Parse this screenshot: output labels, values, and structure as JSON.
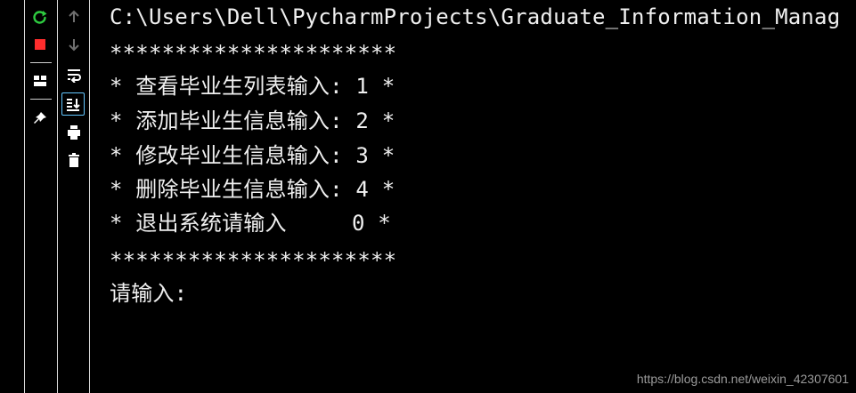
{
  "toolbar_left": {
    "icons": [
      "rerun-icon",
      "stop-icon",
      "layout-icon",
      "pin-icon"
    ]
  },
  "toolbar_mid": {
    "icons": [
      "up-arrow-icon",
      "down-arrow-icon",
      "soft-wrap-icon",
      "scroll-to-end-icon",
      "print-icon",
      "trash-icon"
    ]
  },
  "console": {
    "path": "C:\\Users\\Dell\\PycharmProjects\\Graduate_Information_Manag",
    "border_top": "**********************",
    "menu_items": [
      "* 查看毕业生列表输入: 1 *",
      "* 添加毕业生信息输入: 2 *",
      "* 修改毕业生信息输入: 3 *",
      "* 删除毕业生信息输入: 4 *",
      "* 退出系统请输入     0 *"
    ],
    "border_bottom": "**********************",
    "prompt": "请输入:"
  },
  "watermark": "https://blog.csdn.net/weixin_42307601",
  "colors": {
    "background": "#000000",
    "text": "#f0f0f0",
    "rerun": "#2ecc40",
    "stop": "#ff2d2d",
    "active_border": "#63c7ff"
  }
}
